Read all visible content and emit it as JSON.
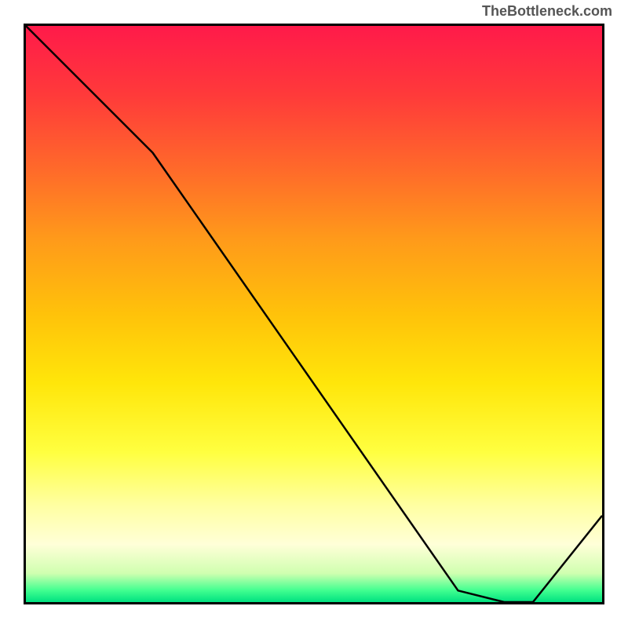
{
  "attribution": "TheBottleneck.com",
  "annotation_text": "",
  "chart_data": {
    "type": "line",
    "title": "",
    "xlabel": "",
    "ylabel": "",
    "xlim": [
      0,
      100
    ],
    "ylim": [
      0,
      100
    ],
    "grid": false,
    "legend": false,
    "series": [
      {
        "name": "curve",
        "x": [
          0,
          22,
          75,
          83,
          88,
          100
        ],
        "values": [
          100,
          78,
          2,
          0,
          0,
          15
        ]
      }
    ],
    "background_gradient": {
      "orientation": "vertical",
      "stops": [
        {
          "pos": 0.0,
          "color": "#ff1a4a"
        },
        {
          "pos": 0.5,
          "color": "#ffe60a"
        },
        {
          "pos": 0.9,
          "color": "#ffffd8"
        },
        {
          "pos": 1.0,
          "color": "#00e080"
        }
      ]
    },
    "annotations": [
      {
        "x_range": [
          75,
          88
        ],
        "y": 0
      }
    ]
  }
}
